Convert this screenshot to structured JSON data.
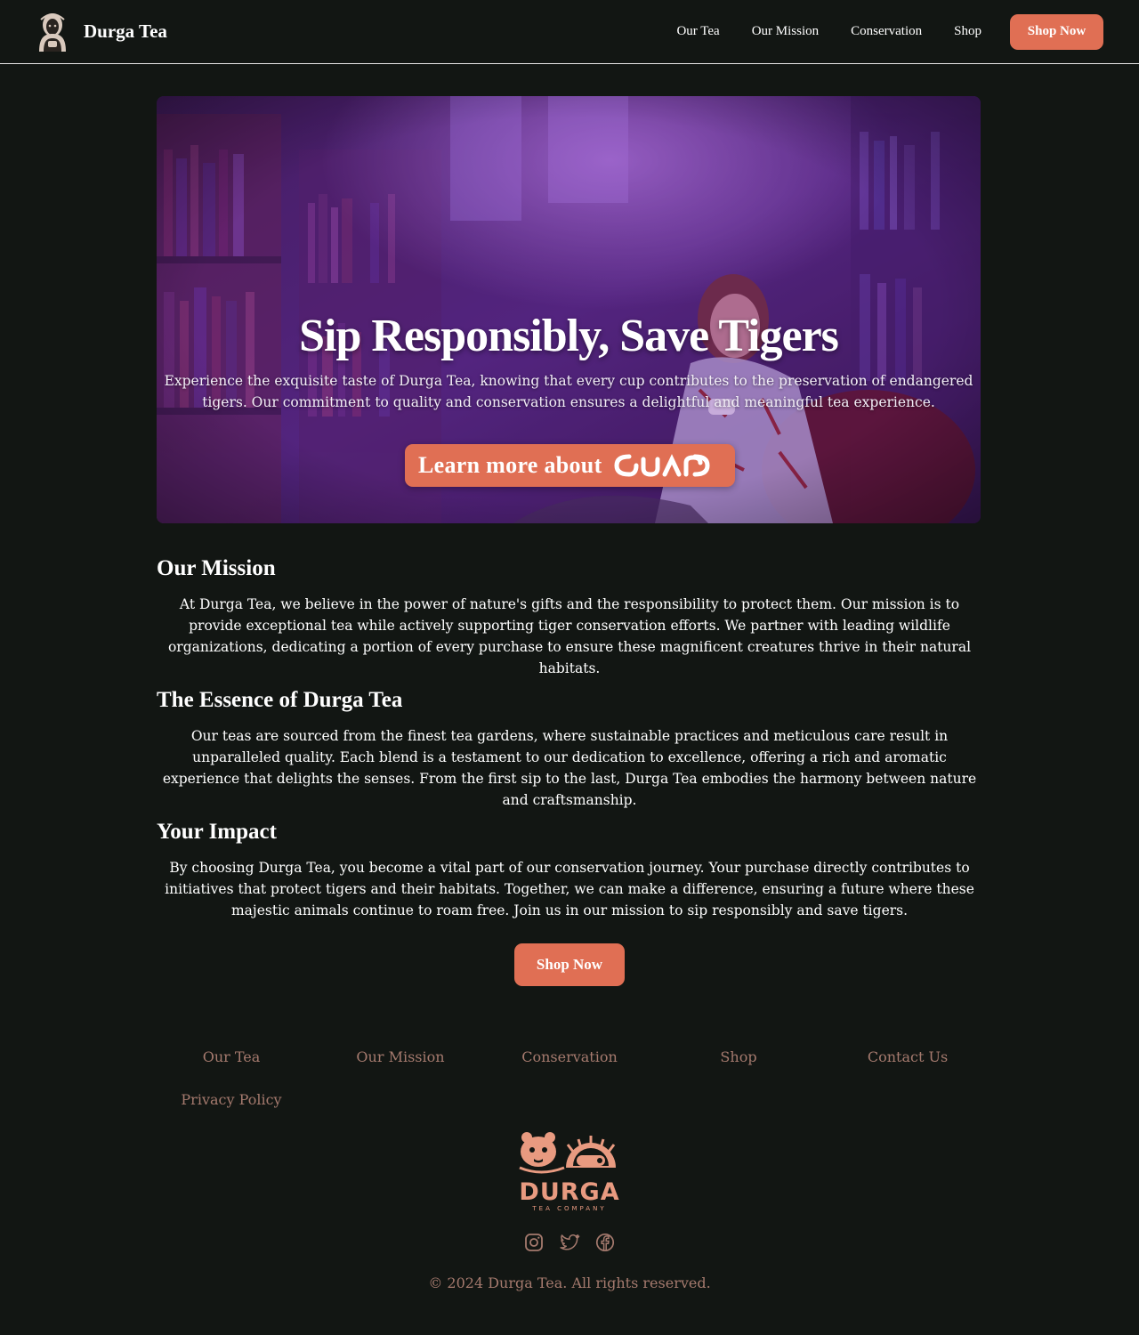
{
  "colors": {
    "background": "#121613",
    "accent": "#e06f54",
    "footer_text": "#a57a6e",
    "text": "#ffffff"
  },
  "header": {
    "brand_name": "Durga Tea",
    "logo_icon": "tea-drinker-logo-icon",
    "nav": [
      "Our Tea",
      "Our Mission",
      "Conservation",
      "Shop"
    ],
    "cta_label": "Shop Now"
  },
  "hero": {
    "image_desc_icon": "woman-drinking-tea-in-library-photo",
    "title": "Sip Responsibly, Save Tigers",
    "description": "Experience the exquisite taste of Durga Tea, knowing that every cup contributes to the preservation of endangered tigers. Our commitment to quality and conservation ensures a delightful and meaningful tea experience.",
    "cta_label": "Learn more about",
    "cta_logo_icon": "durga-wordmark-icon"
  },
  "sections": [
    {
      "heading": "Our Mission",
      "body": "At Durga Tea, we believe in the power of nature's gifts and the responsibility to protect them. Our mission is to provide exceptional tea while actively supporting tiger conservation efforts. We partner with leading wildlife organizations, dedicating a portion of every purchase to ensure these magnificent creatures thrive in their natural habitats."
    },
    {
      "heading": "The Essence of Durga Tea",
      "body": "Our teas are sourced from the finest tea gardens, where sustainable practices and meticulous care result in unparalleled quality. Each blend is a testament to our dedication to excellence, offering a rich and aromatic experience that delights the senses. From the first sip to the last, Durga Tea embodies the harmony between nature and craftsmanship."
    },
    {
      "heading": "Your Impact",
      "body": "By choosing Durga Tea, you become a vital part of our conservation journey. Your purchase directly contributes to initiatives that protect tigers and their habitats. Together, we can make a difference, ensuring a future where these majestic animals continue to roam free. Join us in our mission to sip responsibly and save tigers."
    }
  ],
  "shop_cta_label": "Shop Now",
  "footer": {
    "links": [
      "Our Tea",
      "Our Mission",
      "Conservation",
      "Shop",
      "Contact Us",
      "Privacy Policy"
    ],
    "logo_wordmark": "DURGA",
    "logo_tagline": "TEA COMPANY",
    "social_icons": [
      "instagram-icon",
      "twitter-icon",
      "facebook-icon"
    ],
    "copyright": "© 2024 Durga Tea. All rights reserved."
  }
}
